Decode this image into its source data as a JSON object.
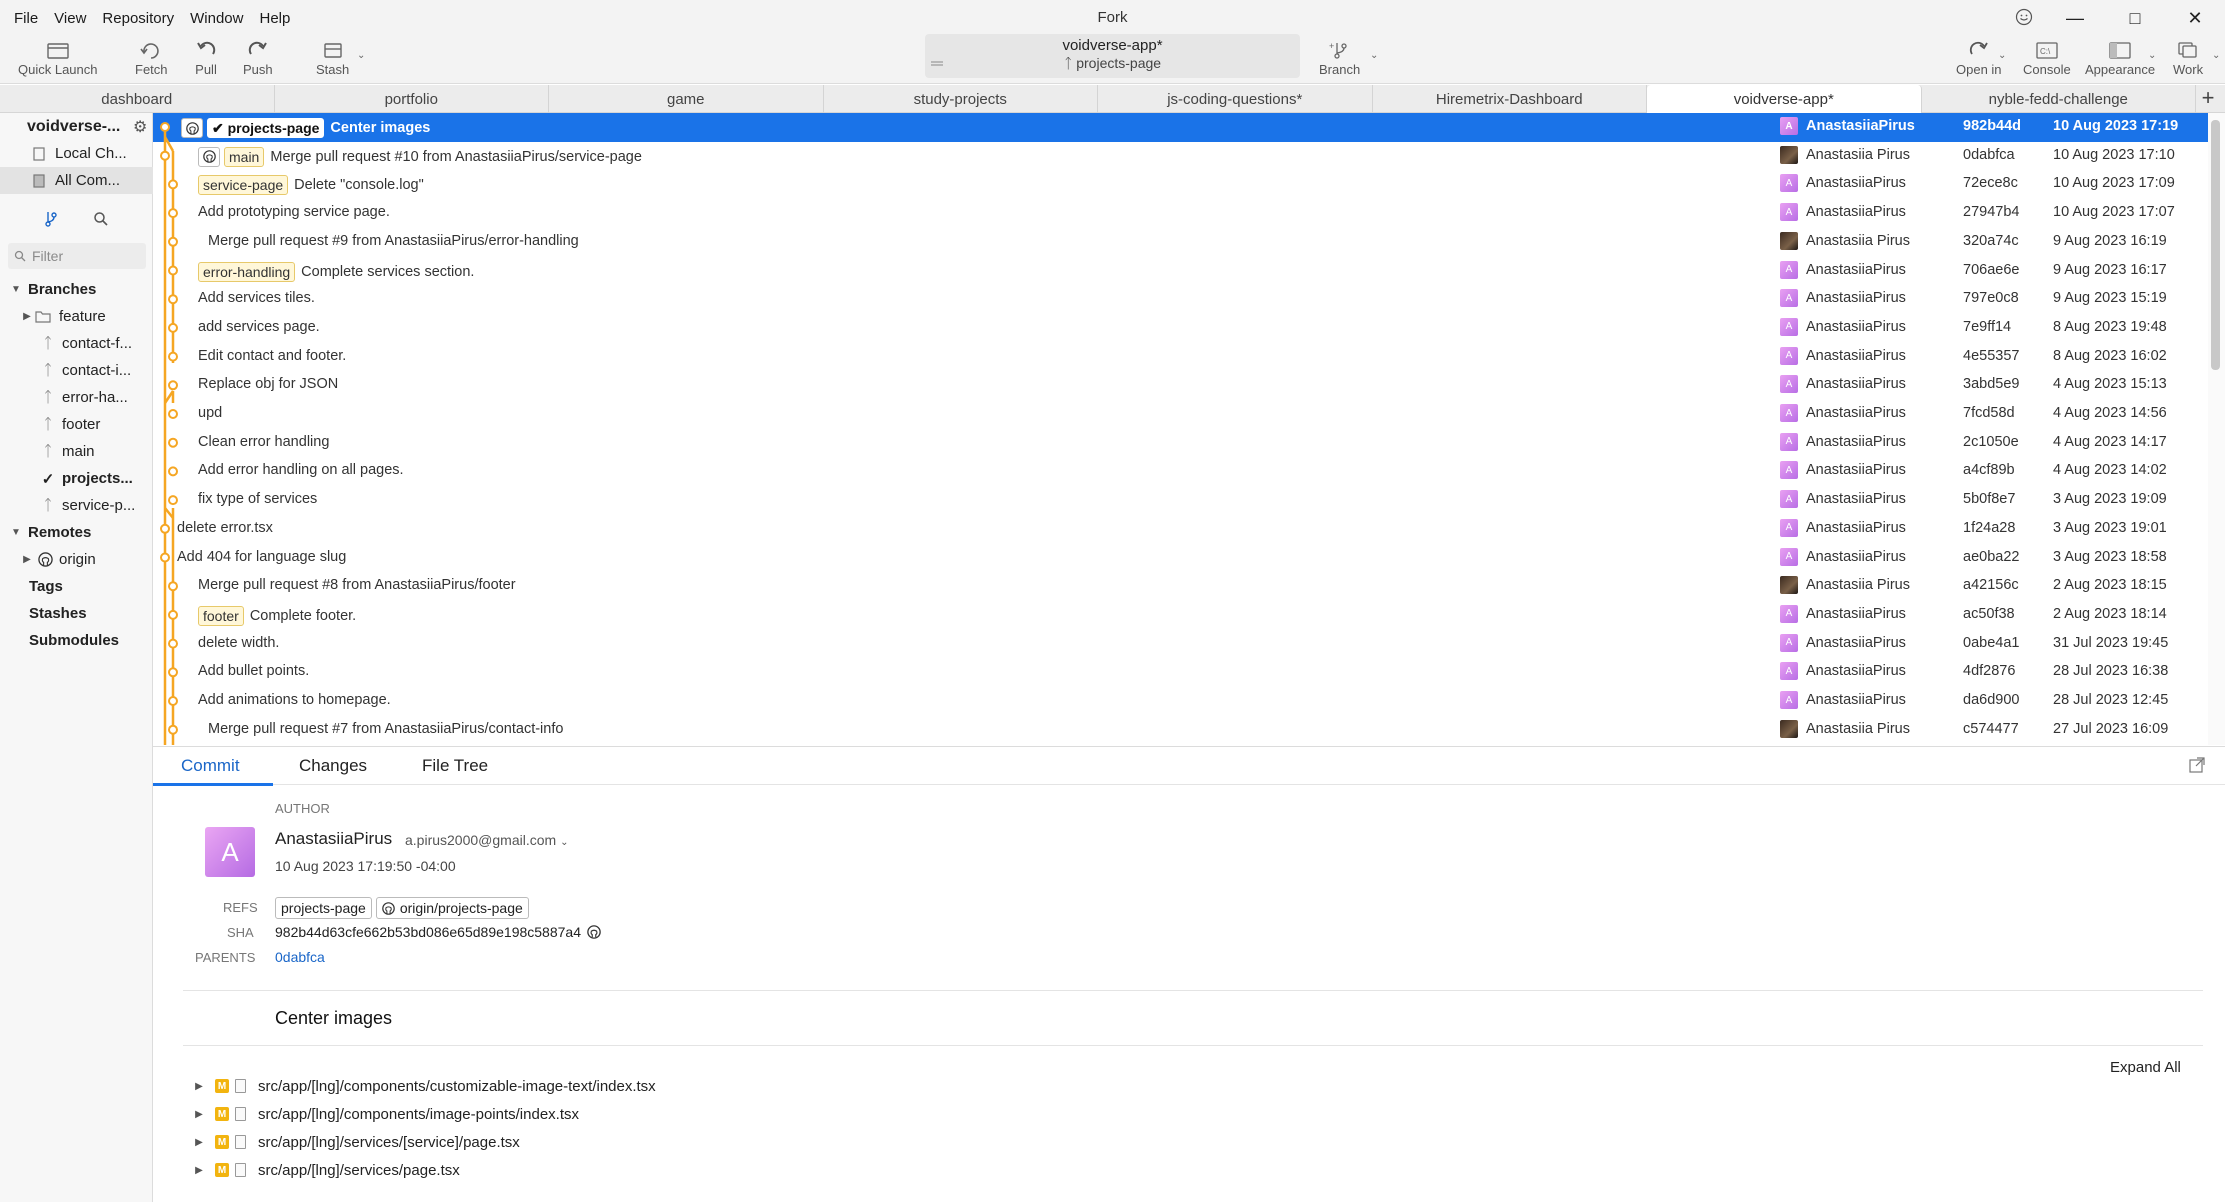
{
  "menu": [
    "File",
    "View",
    "Repository",
    "Window",
    "Help"
  ],
  "app_title": "Fork",
  "toolbar": {
    "quick_launch": "Quick Launch",
    "fetch": "Fetch",
    "pull": "Pull",
    "push": "Push",
    "stash": "Stash",
    "branch": "Branch",
    "open_in": "Open in",
    "console": "Console",
    "appearance": "Appearance",
    "work": "Work",
    "repo_name": "voidverse-app*",
    "repo_branch": "projects-page"
  },
  "tabs": [
    "dashboard",
    "portfolio",
    "game",
    "study-projects",
    "js-coding-questions*",
    "Hiremetrix-Dashboard",
    "voidverse-app*",
    "nyble-fedd-challenge"
  ],
  "sidebar": {
    "repo": "voidverse-...",
    "local_changes": "Local Ch...",
    "all_commits": "All Com...",
    "filter_placeholder": "Filter",
    "branches_header": "Branches",
    "branches": [
      "feature",
      "contact-f...",
      "contact-i...",
      "error-ha...",
      "footer",
      "main",
      "projects...",
      "service-p..."
    ],
    "remotes_header": "Remotes",
    "origin": "origin",
    "tags": "Tags",
    "stashes": "Stashes",
    "submodules": "Submodules"
  },
  "commits": [
    {
      "refs": [
        "projects-page"
      ],
      "msg": "Center images",
      "author": "AnastasiiaPirus",
      "sha": "982b44d",
      "date": "10 Aug 2023 17:19",
      "avatar": "A"
    },
    {
      "refs": [
        "main"
      ],
      "msg": "Merge pull request #10 from AnastasiiaPirus/service-page",
      "author": "Anastasiia Pirus",
      "sha": "0dabfca",
      "date": "10 Aug 2023 17:10",
      "avatar": "photo"
    },
    {
      "refs": [
        "service-page"
      ],
      "msg": "Delete \"console.log\"",
      "author": "AnastasiiaPirus",
      "sha": "72ece8c",
      "date": "10 Aug 2023 17:09",
      "avatar": "A"
    },
    {
      "refs": [],
      "msg": "Add prototyping service page.",
      "author": "AnastasiiaPirus",
      "sha": "27947b4",
      "date": "10 Aug 2023 17:07",
      "avatar": "A"
    },
    {
      "refs": [],
      "msg": "Merge pull request #9 from AnastasiiaPirus/error-handling",
      "author": "Anastasiia Pirus",
      "sha": "320a74c",
      "date": "9 Aug 2023 16:19",
      "avatar": "photo"
    },
    {
      "refs": [
        "error-handling"
      ],
      "msg": "Complete services section.",
      "author": "AnastasiiaPirus",
      "sha": "706ae6e",
      "date": "9 Aug 2023 16:17",
      "avatar": "A"
    },
    {
      "refs": [],
      "msg": "Add services tiles.",
      "author": "AnastasiiaPirus",
      "sha": "797e0c8",
      "date": "9 Aug 2023 15:19",
      "avatar": "A"
    },
    {
      "refs": [],
      "msg": "add services page.",
      "author": "AnastasiiaPirus",
      "sha": "7e9ff14",
      "date": "8 Aug 2023 19:48",
      "avatar": "A"
    },
    {
      "refs": [],
      "msg": "Edit contact and footer.",
      "author": "AnastasiiaPirus",
      "sha": "4e55357",
      "date": "8 Aug 2023 16:02",
      "avatar": "A"
    },
    {
      "refs": [],
      "msg": "Replace obj for JSON",
      "author": "AnastasiiaPirus",
      "sha": "3abd5e9",
      "date": "4 Aug 2023 15:13",
      "avatar": "A"
    },
    {
      "refs": [],
      "msg": "upd",
      "author": "AnastasiiaPirus",
      "sha": "7fcd58d",
      "date": "4 Aug 2023 14:56",
      "avatar": "A"
    },
    {
      "refs": [],
      "msg": "Clean error handling",
      "author": "AnastasiiaPirus",
      "sha": "2c1050e",
      "date": "4 Aug 2023 14:17",
      "avatar": "A"
    },
    {
      "refs": [],
      "msg": "Add error handling on all pages.",
      "author": "AnastasiiaPirus",
      "sha": "a4cf89b",
      "date": "4 Aug 2023 14:02",
      "avatar": "A"
    },
    {
      "refs": [],
      "msg": "fix type of services",
      "author": "AnastasiiaPirus",
      "sha": "5b0f8e7",
      "date": "3 Aug 2023 19:09",
      "avatar": "A"
    },
    {
      "refs": [],
      "msg": "delete error.tsx",
      "author": "AnastasiiaPirus",
      "sha": "1f24a28",
      "date": "3 Aug 2023 19:01",
      "avatar": "A"
    },
    {
      "refs": [],
      "msg": "Add 404 for language slug",
      "author": "AnastasiiaPirus",
      "sha": "ae0ba22",
      "date": "3 Aug 2023 18:58",
      "avatar": "A"
    },
    {
      "refs": [],
      "msg": "Merge pull request #8 from AnastasiiaPirus/footer",
      "author": "Anastasiia Pirus",
      "sha": "a42156c",
      "date": "2 Aug 2023 18:15",
      "avatar": "photo"
    },
    {
      "refs": [
        "footer"
      ],
      "msg": "Complete footer.",
      "author": "AnastasiiaPirus",
      "sha": "ac50f38",
      "date": "2 Aug 2023 18:14",
      "avatar": "A"
    },
    {
      "refs": [],
      "msg": "delete width.",
      "author": "AnastasiiaPirus",
      "sha": "0abe4a1",
      "date": "31 Jul 2023 19:45",
      "avatar": "A"
    },
    {
      "refs": [],
      "msg": "Add bullet points.",
      "author": "AnastasiiaPirus",
      "sha": "4df2876",
      "date": "28 Jul 2023 16:38",
      "avatar": "A"
    },
    {
      "refs": [],
      "msg": "Add animations to homepage.",
      "author": "AnastasiiaPirus",
      "sha": "da6d900",
      "date": "28 Jul 2023 12:45",
      "avatar": "A"
    },
    {
      "refs": [],
      "msg": "Merge pull request #7 from AnastasiiaPirus/contact-info",
      "author": "Anastasiia Pirus",
      "sha": "c574477",
      "date": "27 Jul 2023 16:09",
      "avatar": "photo"
    }
  ],
  "detail": {
    "tabs": [
      "Commit",
      "Changes",
      "File Tree"
    ],
    "author_label": "AUTHOR",
    "author_initial": "A",
    "author_name": "AnastasiiaPirus",
    "author_email": "a.pirus2000@gmail.com",
    "author_date": "10 Aug 2023 17:19:50 -04:00",
    "refs_label": "REFS",
    "refs": [
      "projects-page",
      "origin/projects-page"
    ],
    "sha_label": "SHA",
    "sha": "982b44d63cfe662b53bd086e65d89e198c5887a4",
    "parents_label": "PARENTS",
    "parent": "0dabfca",
    "subject": "Center images",
    "expand_all": "Expand All",
    "files": [
      "src/app/[lng]/components/customizable-image-text/index.tsx",
      "src/app/[lng]/components/image-points/index.tsx",
      "src/app/[lng]/services/[service]/page.tsx",
      "src/app/[lng]/services/page.tsx"
    ],
    "file_status": "M"
  },
  "colors": {
    "accent": "#1a73e8",
    "graph": "#f5a623",
    "ref_bg": "#fff7d9",
    "modified_badge": "#f2b40f"
  }
}
